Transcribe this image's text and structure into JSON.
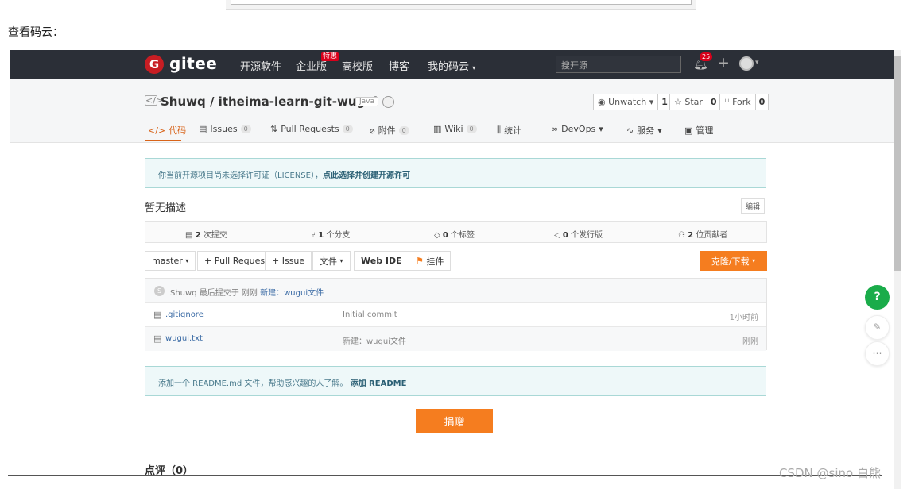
{
  "intro_text": "查看码云：",
  "nav": {
    "logo_letter": "G",
    "logo_text": "gitee",
    "links": [
      "开源软件",
      "企业版",
      "高校版",
      "博客",
      "我的码云"
    ],
    "special_tag": "特惠",
    "search_placeholder": "搜开源",
    "notification_count": "25"
  },
  "repo": {
    "title": "Shuwq / itheima-learn-git-wugui",
    "language": "Java",
    "unwatch_label": "Unwatch",
    "unwatch_count": "1",
    "star_label": "Star",
    "star_count": "0",
    "fork_label": "Fork",
    "fork_count": "0"
  },
  "tabs": [
    {
      "label": "代码"
    },
    {
      "label": "Issues",
      "count": "0"
    },
    {
      "label": "Pull Requests",
      "count": "0"
    },
    {
      "label": "附件",
      "count": "0"
    },
    {
      "label": "Wiki",
      "count": "0"
    },
    {
      "label": "统计"
    },
    {
      "label": "DevOps"
    },
    {
      "label": "服务"
    },
    {
      "label": "管理"
    }
  ],
  "license_notice": {
    "text": "你当前开源项目尚未选择许可证（LICENSE），",
    "link": "点此选择并创建开源许可"
  },
  "description": "暂无描述",
  "edit_label": "编辑",
  "stats": [
    {
      "count": "2",
      "label": "次提交"
    },
    {
      "count": "1",
      "label": "个分支"
    },
    {
      "count": "0",
      "label": "个标签"
    },
    {
      "count": "0",
      "label": "个发行版"
    },
    {
      "count": "2",
      "label": "位贡献者"
    }
  ],
  "toolbar": {
    "branch": "master",
    "pull_request": "+ Pull Request",
    "issue": "+ Issue",
    "file": "文件",
    "web_ide": "Web IDE",
    "attach": "挂件",
    "clone": "克隆/下载"
  },
  "commit": {
    "avatar_letter": "S",
    "author": "Shuwq",
    "text": "最后提交于 刚刚",
    "message": "新建：wugui文件"
  },
  "files": [
    {
      "name": ".gitignore",
      "message": "Initial commit",
      "time": "1小时前"
    },
    {
      "name": "wugui.txt",
      "message": "新建：wugui文件",
      "time": "刚刚"
    }
  ],
  "readme_notice": {
    "text": "添加一个 README.md 文件，帮助感兴趣的人了解。",
    "link": "添加 README"
  },
  "donate": "捐赠",
  "comments": "点评（0）",
  "watermark": "CSDN @sino 白熊"
}
